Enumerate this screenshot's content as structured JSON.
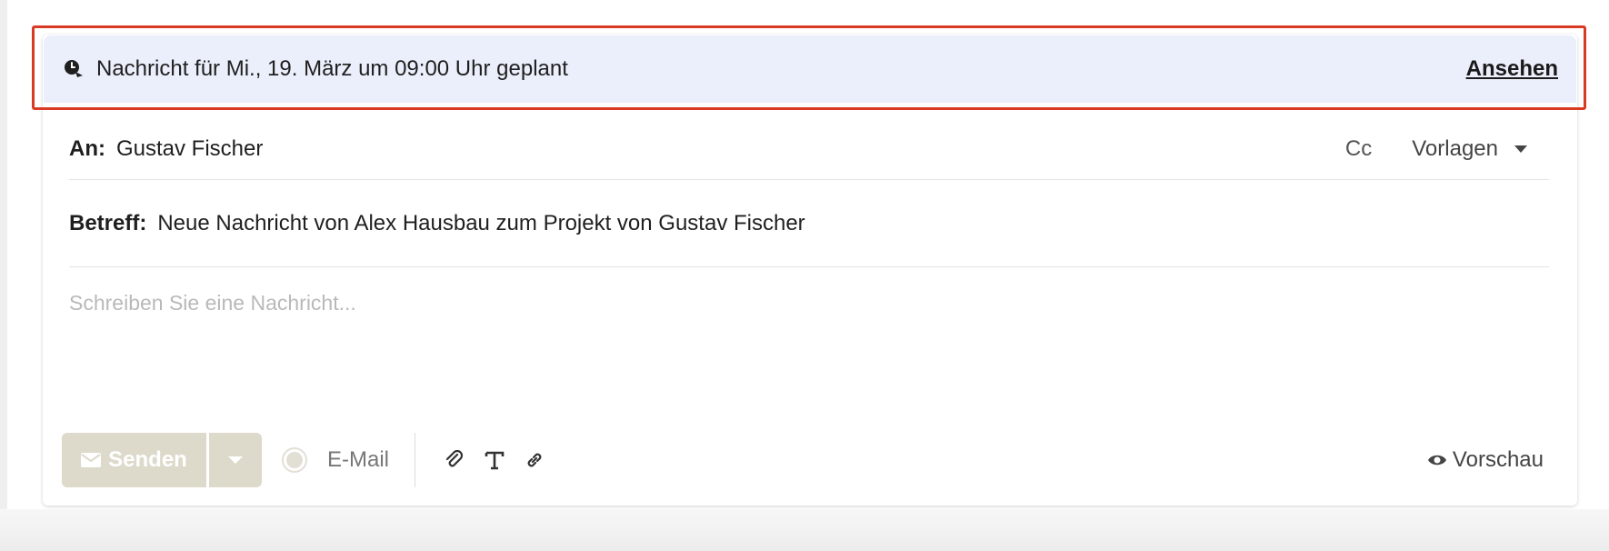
{
  "scheduled": {
    "text": "Nachricht für Mi., 19. März um 09:00 Uhr geplant",
    "link_label": "Ansehen",
    "icon": "scheduled-clock-icon"
  },
  "recipient": {
    "label": "An:",
    "value": "Gustav Fischer",
    "cc_label": "Cc",
    "templates_label": "Vorlagen"
  },
  "subject": {
    "label": "Betreff:",
    "value": "Neue Nachricht von Alex Hausbau zum Projekt von Gustav Fischer"
  },
  "message": {
    "placeholder": "Schreiben Sie eine Nachricht..."
  },
  "toolbar": {
    "send_label": "Senden",
    "channel_label": "E-Mail",
    "preview_label": "Vorschau",
    "icons": [
      "envelope-icon",
      "chevron-down-icon",
      "attachment-icon",
      "text-format-icon",
      "link-icon",
      "eye-icon"
    ]
  },
  "colors": {
    "banner_bg": "#ebeffb",
    "highlight_border": "#d83a24",
    "send_button_bg": "#ddd9cb"
  }
}
